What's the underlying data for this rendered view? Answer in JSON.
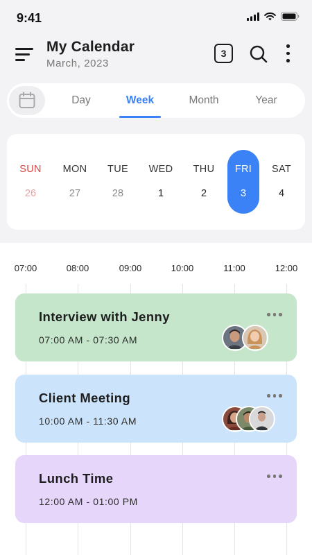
{
  "status_bar": {
    "time": "9:41"
  },
  "header": {
    "title": "My Calendar",
    "subtitle": "March, 2023",
    "today_badge": "3"
  },
  "tabs": [
    {
      "label": "Day",
      "active": false
    },
    {
      "label": "Week",
      "active": true
    },
    {
      "label": "Month",
      "active": false
    },
    {
      "label": "Year",
      "active": false
    }
  ],
  "week": {
    "days": [
      {
        "name": "SUN",
        "date": "26"
      },
      {
        "name": "MON",
        "date": "27"
      },
      {
        "name": "TUE",
        "date": "28"
      },
      {
        "name": "WED",
        "date": "1"
      },
      {
        "name": "THU",
        "date": "2"
      },
      {
        "name": "FRI",
        "date": "3"
      },
      {
        "name": "SAT",
        "date": "4"
      }
    ],
    "selected": "FRI"
  },
  "timeline": {
    "times": [
      "07:00",
      "08:00",
      "09:00",
      "10:00",
      "11:00",
      "12:00"
    ]
  },
  "events": [
    {
      "title": "Interview with Jenny",
      "time": "07:00 AM - 07:30 AM",
      "color": "#c6e6cc"
    },
    {
      "title": "Client Meeting",
      "time": "10:00 AM - 11:30 AM",
      "color": "#cce4fb"
    },
    {
      "title": "Lunch Time",
      "time": "12:00 AM - 01:00 PM",
      "color": "#e6d6fa"
    }
  ],
  "colors": {
    "accent": "#3b82f6",
    "sunday": "#d64545"
  }
}
